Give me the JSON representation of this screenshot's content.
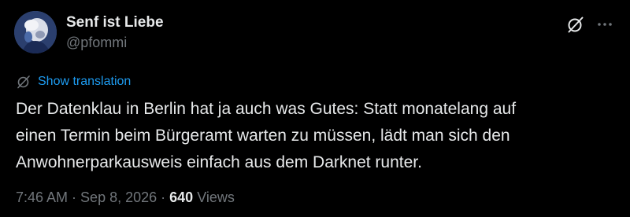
{
  "author": {
    "display_name": "Senf ist Liebe",
    "handle": "@pfommi",
    "avatar_icon": "profile-photo"
  },
  "actions": {
    "grok_icon": "grok-slash-circle-icon",
    "more_icon": "more-horizontal-icon"
  },
  "translation": {
    "label": "Show translation",
    "icon": "translate-slash-circle-icon"
  },
  "tweet": {
    "lines": [
      "Der Datenklau in Berlin hat ja auch was Gutes: Statt monatelang auf",
      "einen Termin beim Bürgeramt warten zu müssen, lädt man sich den",
      "Anwohnerparkausweis einfach aus dem Darknet runter."
    ]
  },
  "meta": {
    "time": "7:46 AM",
    "separator": " · ",
    "date": "Sep 8, 2026",
    "views_count": "640",
    "views_label": "Views"
  },
  "colors": {
    "background": "#000000",
    "text": "#e7e9ea",
    "secondary": "#71767b",
    "link": "#1d9bf0"
  }
}
